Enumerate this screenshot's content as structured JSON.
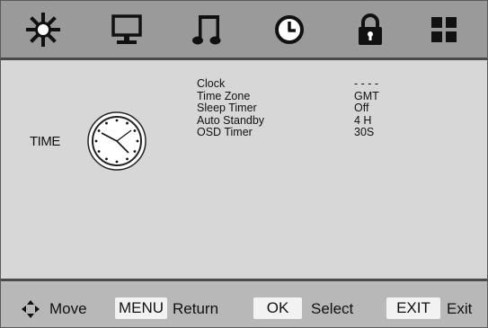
{
  "tabs": [
    {
      "name": "picture-tab",
      "icon": "sun-icon"
    },
    {
      "name": "pc-tab",
      "icon": "monitor-icon"
    },
    {
      "name": "sound-tab",
      "icon": "music-note-icon"
    },
    {
      "name": "time-tab",
      "icon": "clock-icon"
    },
    {
      "name": "lock-tab",
      "icon": "lock-icon"
    },
    {
      "name": "setup-tab",
      "icon": "grid-icon"
    }
  ],
  "section": {
    "label": "TIME"
  },
  "menu": [
    {
      "label": "Clock",
      "value": "- - - -"
    },
    {
      "label": "Time Zone",
      "value": "GMT"
    },
    {
      "label": "Sleep Timer",
      "value": "Off"
    },
    {
      "label": "Auto Standby",
      "value": "4 H"
    },
    {
      "label": "OSD Timer",
      "value": "30S"
    }
  ],
  "footer": {
    "move_label": "Move",
    "menu_key": "MENU",
    "return_label": "Return",
    "ok_key": "OK",
    "select_label": "Select",
    "exit_key": "EXIT",
    "exit_label": "Exit"
  },
  "colors": {
    "topbar": "#9a9a9a",
    "panel": "#d7d7d7",
    "footer": "#b8b8b8",
    "key": "#f2f2f2"
  }
}
